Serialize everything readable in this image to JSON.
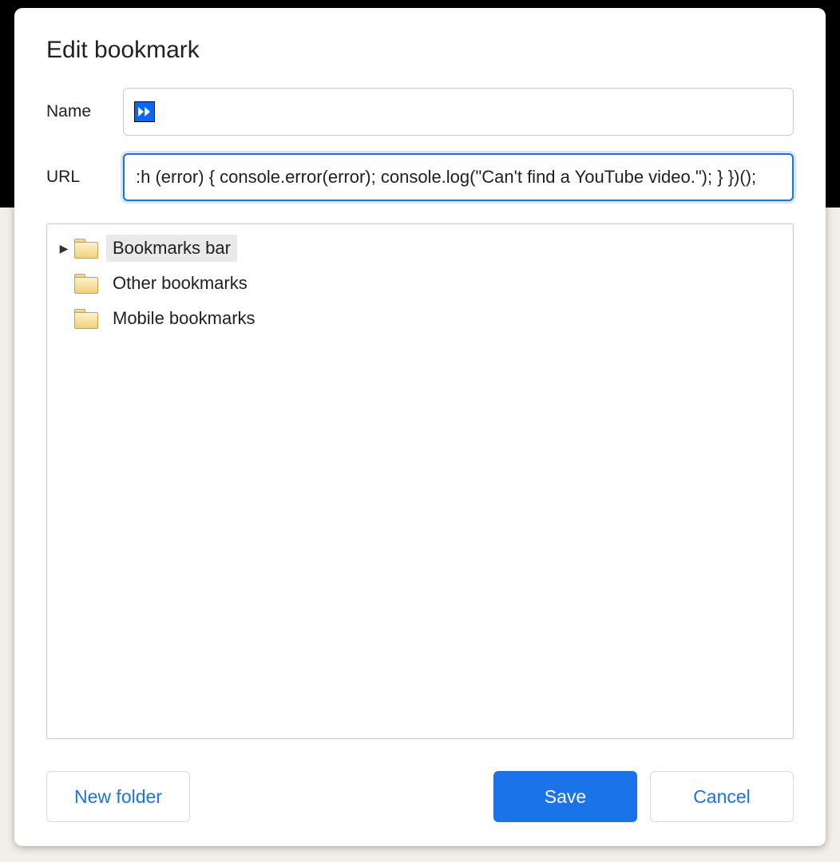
{
  "dialog": {
    "title": "Edit bookmark",
    "name_label": "Name",
    "name_value": "",
    "url_label": "URL",
    "url_value": ":h (error) { console.error(error); console.log(\"Can't find a YouTube video.\"); } })();"
  },
  "folders": {
    "items": [
      {
        "label": "Bookmarks bar",
        "expandable": true,
        "selected": true
      },
      {
        "label": "Other bookmarks",
        "expandable": false,
        "selected": false
      },
      {
        "label": "Mobile bookmarks",
        "expandable": false,
        "selected": false
      }
    ]
  },
  "buttons": {
    "new_folder": "New folder",
    "save": "Save",
    "cancel": "Cancel"
  },
  "icons": {
    "bookmark_favicon": "fast-forward"
  }
}
